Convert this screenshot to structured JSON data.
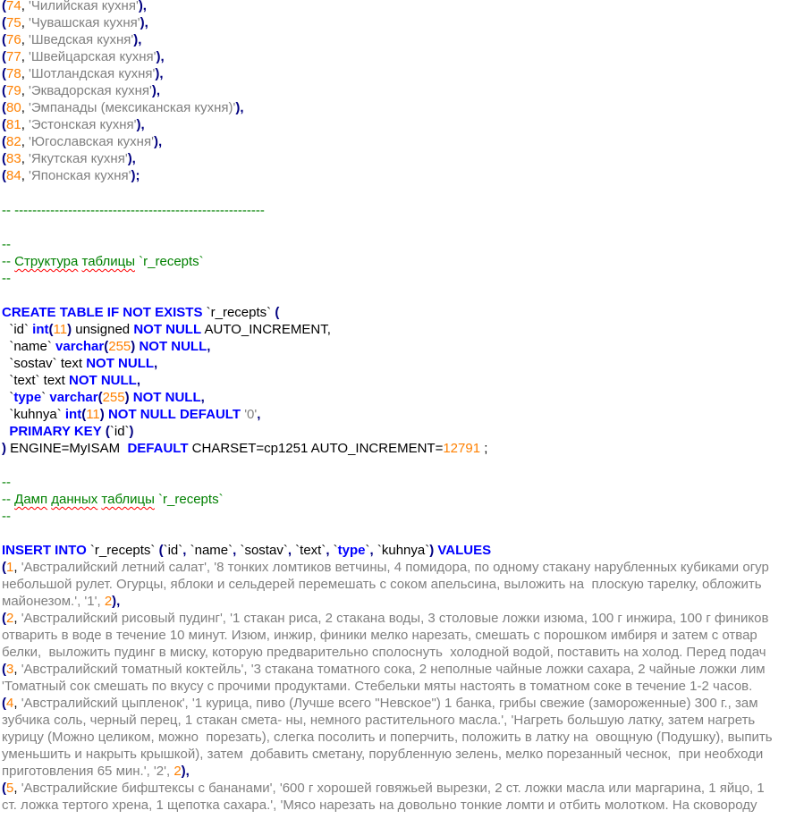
{
  "cuisines": [
    {
      "id": "74",
      "name": "'Чилийская кухня'"
    },
    {
      "id": "75",
      "name": "'Чувашская кухня'"
    },
    {
      "id": "76",
      "name": "'Шведская кухня'"
    },
    {
      "id": "77",
      "name": "'Швейцарская кухня'"
    },
    {
      "id": "78",
      "name": "'Шотландская кухня'"
    },
    {
      "id": "79",
      "name": "'Эквадорская кухня'"
    },
    {
      "id": "80",
      "name": "'Эмпанады (мексиканская кухня)'"
    },
    {
      "id": "81",
      "name": "'Эстонская кухня'"
    },
    {
      "id": "82",
      "name": "'Югославская кухня'"
    },
    {
      "id": "83",
      "name": "'Якутская кухня'"
    },
    {
      "id": "84",
      "name": "'Японская кухня'"
    }
  ],
  "separator": "-- --------------------------------------------------------",
  "comment_dash": "--",
  "struct_comment": {
    "prefix": "-- ",
    "w1": "Структура",
    "w2": "таблицы",
    "rest": " `r_recepts`"
  },
  "dump_comment": {
    "prefix": "-- ",
    "w1": "Дамп",
    "w2": "данных",
    "w3": "таблицы",
    "rest": " `r_recepts`"
  },
  "create": {
    "kw": "CREATE TABLE IF NOT EXISTS",
    "table": " `r_recepts` ",
    "open": "(",
    "id_col": "  `id` ",
    "int": "int",
    "n11": "11",
    "unsigned": " unsigned ",
    "notnull": "NOT NULL",
    "ai": " AUTO_INCREMENT,",
    "name_col": "  `name` ",
    "varchar": "varchar",
    "n255": "255",
    "sostav_col": "  `sostav` text ",
    "text_col": "  `text` text ",
    "type_col": "type",
    "kuhnya_col": "  `kuhnya` ",
    "default": "DEFAULT",
    "zero": "'0'",
    "pk": "PRIMARY KEY",
    "pk_col": "`id`",
    "engine": " ENGINE=MyISAM  ",
    "charset": " CHARSET=cp1251 AUTO_INCREMENT=",
    "ai_val": "12791",
    "end": " ;"
  },
  "insert": {
    "kw": "INSERT INTO",
    "table": " `r_recepts` ",
    "c1": "`id`",
    "c2": "`name`",
    "c3": "`sostav`",
    "c4": "`text`",
    "c5": "type",
    "c6": "`kuhnya`",
    "values": "VALUES"
  },
  "rows": [
    {
      "id": "1",
      "l1": "'Австралийский летний салат', '8 тонких ломтиков ветчины, 4 помидора, по одному стакану нарубленных кубиками огур",
      "l2": "небольшой рулет. Огурцы, яблоки и сельдерей перемешать с соком апельсина, выложить на  плоскую тарелку, обложить",
      "l3": "майонезом.', '1', ",
      "tail": "2"
    },
    {
      "id": "2",
      "l1": "'Австралийский рисовый пудинг', '1 стакан риса, 2 стакана воды, 3 столовые ложки изюма, 100 г инжира, 100 г фиников",
      "l2": "отварить в воде в течение 10 минут. Изюм, инжир, финики мелко нарезать, смешать с порошком имбиря и затем с отвар",
      "l3": "белки,  выложить пудинг в миску, которую предварительно сполоснуть  холодной водой, поставить на холод. Перед подач"
    },
    {
      "id": "3",
      "l1": "'Австралийский томатный коктейль', '3 стакана томатного сока, 2 неполные чайные ложки сахара, 2 чайные ложки лим",
      "l2": "'Томатный сок смешать по вкусу с прочими продуктами. Стебельки мяты настоять в томатном соке в течение 1-2 часов."
    },
    {
      "id": "4",
      "l1": "'Австралийский цыпленок', '1 курица, пиво (Лучше всего \"Невское\") 1 банка, грибы свежие (замороженные) 300 г., зам",
      "l2": "зубчика соль, черный перец, 1 стакан смета- ны, немного растительного масла.', 'Нагреть большую латку, затем нагреть",
      "l3": "курицу (Можно целиком, можно  порезать), слегка посолить и поперчить, положить в латку на  овощную (Подушку), выпить",
      "l4": "уменьшить и накрыть крышкой), затем  добавить сметану, порубленную зелень, мелко порезанный чеснок,  при необходи",
      "l5": "приготовления 65 мин.', '2', ",
      "tail": "2"
    },
    {
      "id": "5",
      "l1": "'Австралийские бифштексы с бананами', '600 г хорошей говяжьей вырезки, 2 ст. ложки масла или маргарина, 1 яйцо, 1",
      "l2": "ст. ложка тертого хрена, 1 щепотка сахара.', 'Мясо нарезать на довольно тонкие ломти и отбить молотком. На сковороду"
    }
  ]
}
